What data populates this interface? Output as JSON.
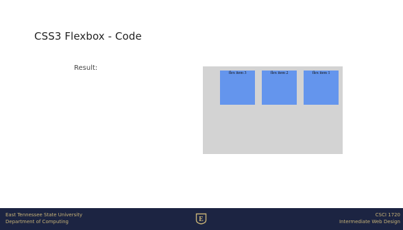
{
  "slide": {
    "title": "CSS3 Flexbox - Code",
    "result_label": "Result:"
  },
  "demo": {
    "background_color": "#d3d3d3",
    "item_color": "#6495ed",
    "items": [
      {
        "label": "flex item 3"
      },
      {
        "label": "flex item 2"
      },
      {
        "label": "flex item 1"
      }
    ]
  },
  "footer": {
    "university": "East Tennessee State University",
    "department": "Department of Computing",
    "course_code": "CSCI 1720",
    "course_name": "Intermediate Web Design",
    "logo_letter": "E",
    "background_color": "#1c2442",
    "text_color": "#c7b277"
  }
}
